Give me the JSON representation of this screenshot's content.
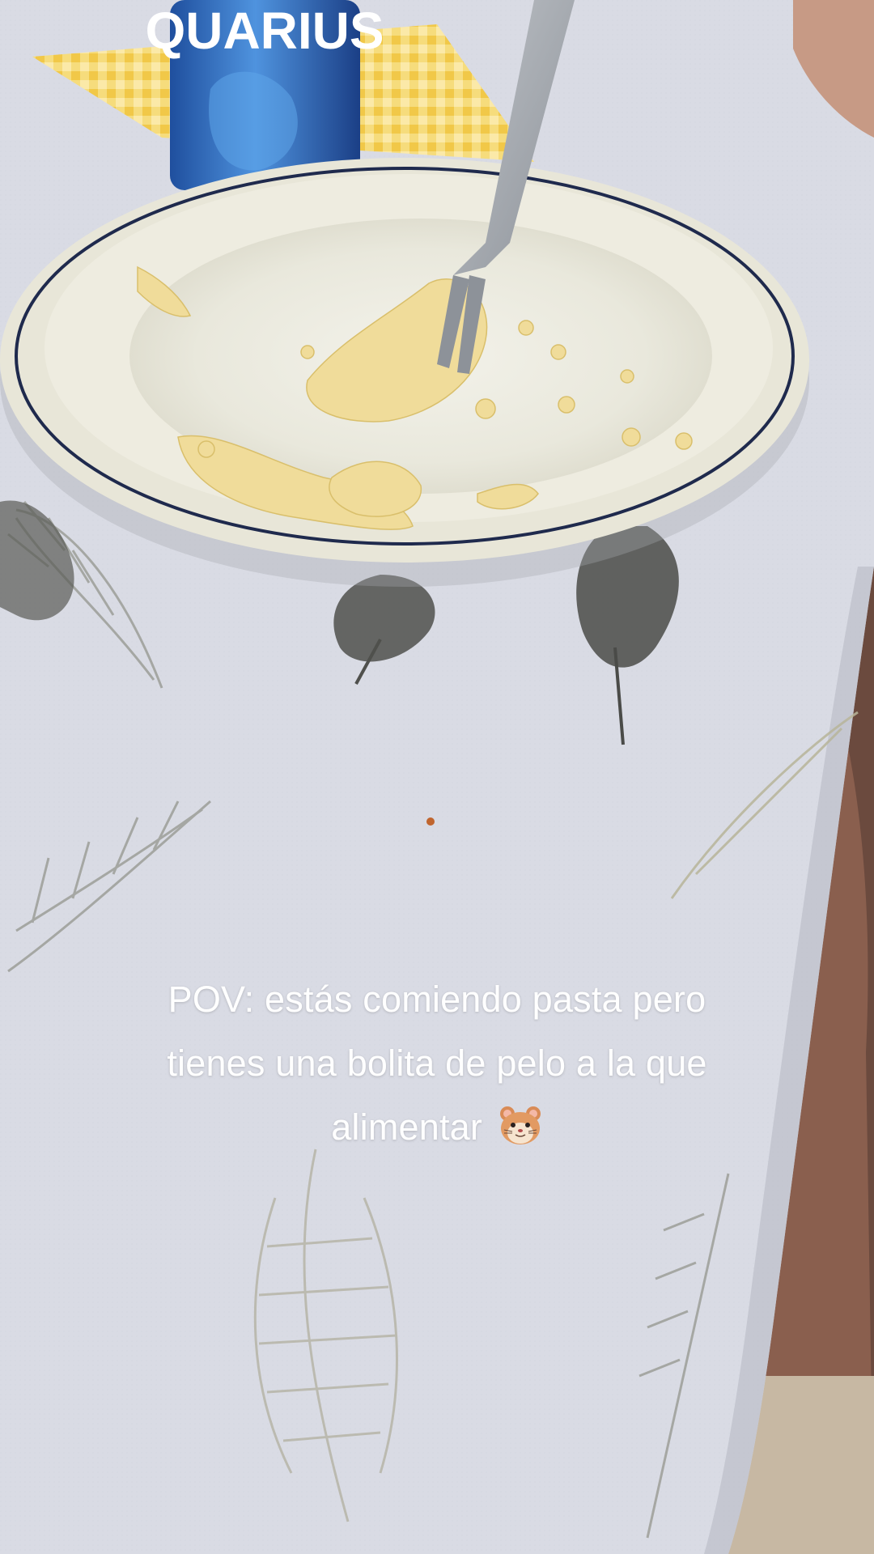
{
  "caption": {
    "line1": "POV: estás comiendo pasta pero",
    "line2": "tienes una bolita de pelo a la que",
    "line3": "alimentar",
    "emoji": "hamster-face-icon"
  },
  "scene": {
    "can_label": "QUARIUS",
    "colors": {
      "tablecloth": "#d7d9e2",
      "bowl": "#ecebe0",
      "bowl_rim_line": "#1f2a4d",
      "pasta": "#f0dc9a",
      "napkin": "#f4d36a",
      "can": "#2f6fc0",
      "floor": "#c8b9a4",
      "skin": "#a97a63"
    }
  }
}
